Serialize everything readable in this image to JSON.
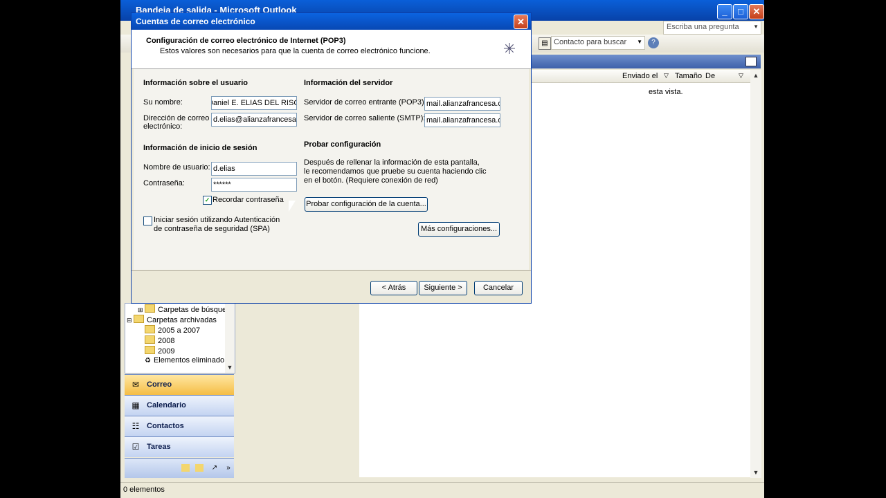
{
  "outlook": {
    "title": "Bandeja de salida - Microsoft Outlook",
    "help_placeholder": "Escriba una pregunta",
    "contact_search": "Contacto para buscar",
    "columns": [
      "Enviado el",
      "Tamaño",
      "De"
    ],
    "empty_message": "esta vista.",
    "tree": [
      {
        "label": "Carpetas de búsque",
        "indent": 1
      },
      {
        "label": "Carpetas archivadas",
        "indent": 0
      },
      {
        "label": "2005 a 2007",
        "indent": 2
      },
      {
        "label": "2008",
        "indent": 2
      },
      {
        "label": "2009",
        "indent": 2
      },
      {
        "label": "Elementos eliminado",
        "indent": 2
      }
    ],
    "nav": [
      "Correo",
      "Calendario",
      "Contactos",
      "Tareas"
    ],
    "status": "0 elementos"
  },
  "dialog": {
    "title": "Cuentas de correo electrónico",
    "heading": "Configuración de correo electrónico de Internet (POP3)",
    "subheading": "Estos valores son necesarios para que la cuenta de correo electrónico funcione.",
    "user_section": "Información sobre el usuario",
    "name_label": "Su nombre:",
    "name_value": "Daniel E. ELIAS DEL RISCO",
    "email_label_1": "Dirección de correo",
    "email_label_2": "electrónico:",
    "email_value": "d.elias@alianzafrancesa.org",
    "login_section": "Información de inicio de sesión",
    "username_label": "Nombre de usuario:",
    "username_value": "d.elias",
    "password_label": "Contraseña:",
    "password_value": "******",
    "remember_label": "Recordar contraseña",
    "remember_checked": true,
    "spa_label_1": "Iniciar sesión utilizando Autenticación",
    "spa_label_2": "de contraseña de seguridad (SPA)",
    "server_section": "Información del servidor",
    "incoming_label": "Servidor de correo entrante (POP3):",
    "incoming_value": "mail.alianzafrancesa.org",
    "outgoing_label": "Servidor de correo saliente (SMTP):",
    "outgoing_value": "mail.alianzafrancesa.org",
    "test_section": "Probar configuración",
    "test_desc_1": "Después de rellenar la información de esta pantalla,",
    "test_desc_2": "le recomendamos que pruebe su cuenta haciendo clic",
    "test_desc_3": "en el botón. (Requiere conexión de red)",
    "test_button": "Probar configuración de la cuenta...",
    "more_button": "Más configuraciones...",
    "back_button": "< Atrás",
    "next_button": "Siguiente >",
    "cancel_button": "Cancelar"
  }
}
